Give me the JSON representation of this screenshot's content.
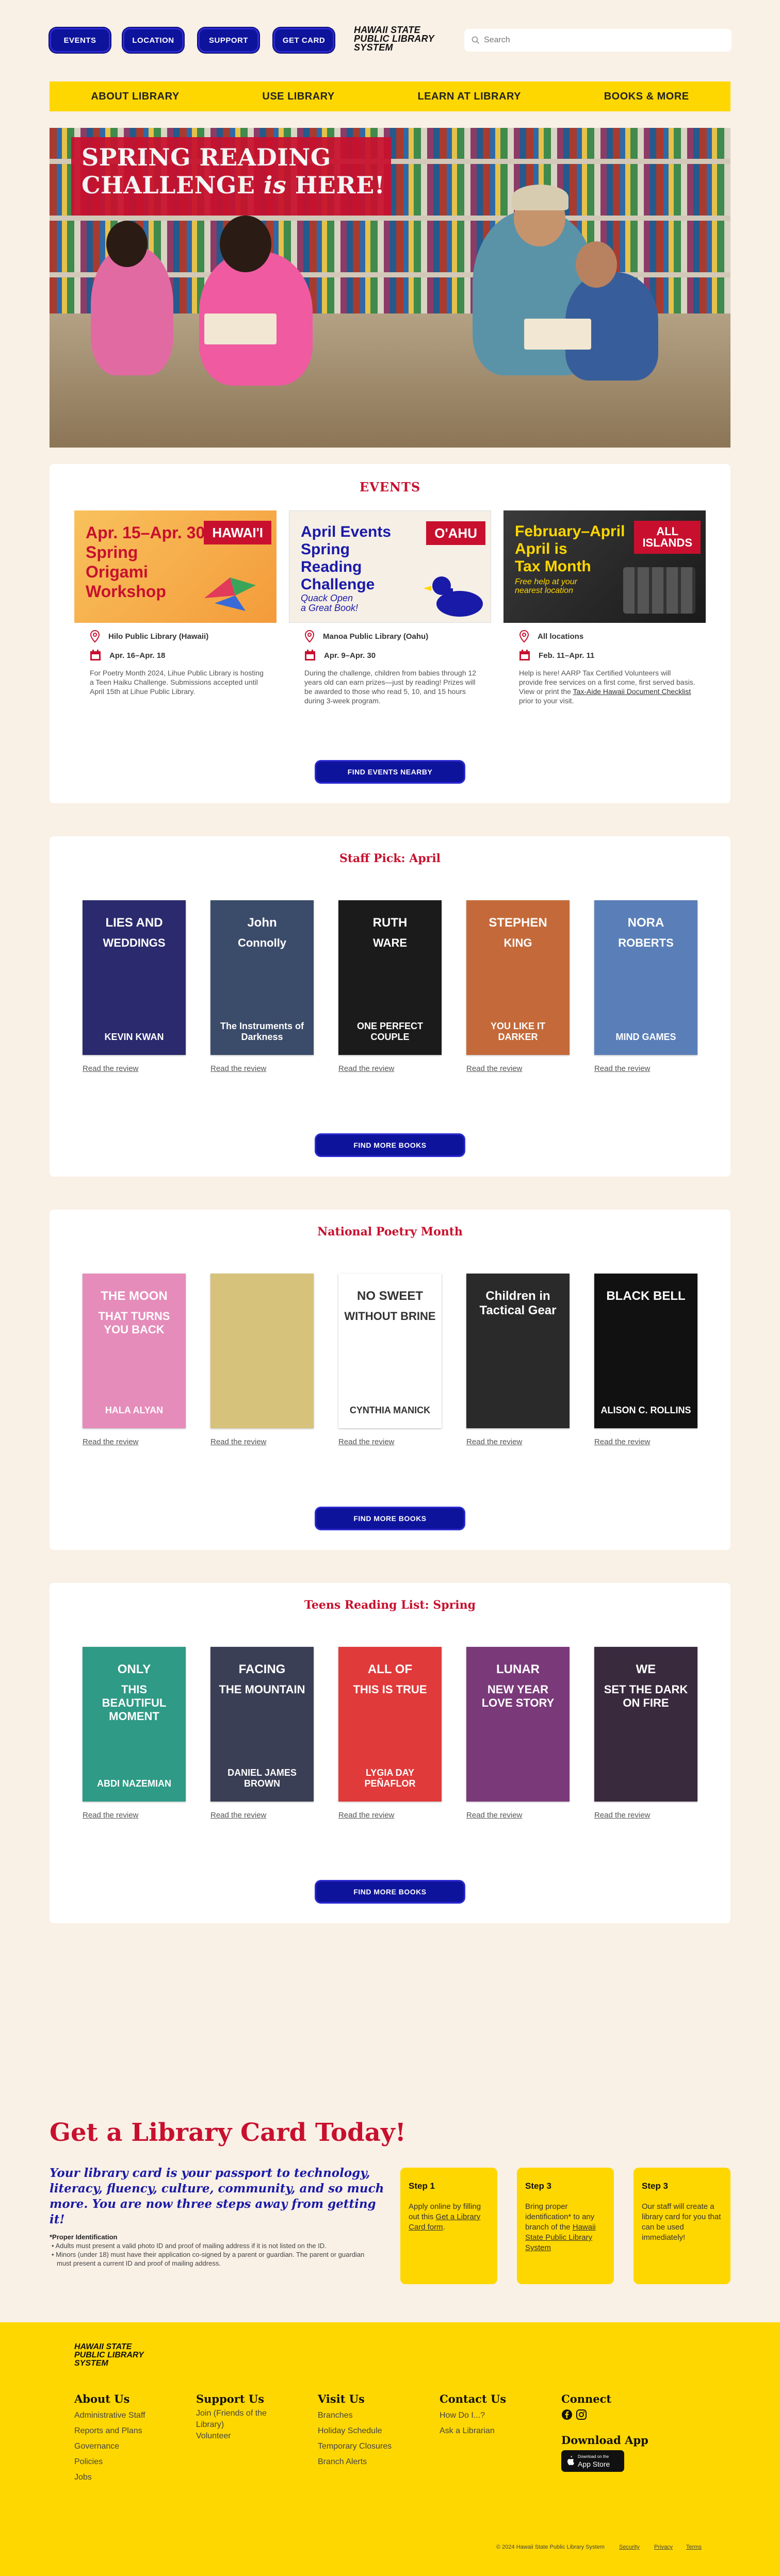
{
  "topnav": {
    "events": "EVENTS",
    "location": "LOCATION",
    "support": "SUPPORT",
    "getcard": "GET CARD"
  },
  "logo": {
    "line1": "HAWAII STATE",
    "line2": "PUBLIC LIBRARY",
    "line3": "SYSTEM"
  },
  "search": {
    "placeholder": "Search"
  },
  "mainnav": [
    "ABOUT LIBRARY",
    "USE LIBRARY",
    "LEARN AT LIBRARY",
    "BOOKS & MORE"
  ],
  "hero": {
    "line1": "SPRING READING",
    "line2a": "CHALLENGE ",
    "line2b": "is",
    "line2c": " HERE!"
  },
  "events": {
    "title": "EVENTS",
    "items": [
      {
        "img_title": "Apr. 15–Apr. 30\nSpring\nOrigami\nWorkshop",
        "tag": "HAWAI'I",
        "location": "Hilo Public Library (Hawaii)",
        "dates": "Apr. 16–Apr. 18",
        "desc": "For Poetry Month 2024, Lihue Public Library is hosting a Teen Haiku Challenge. Submissions accepted until April 15th at Lihue Public Library."
      },
      {
        "img_title": "April Events\nSpring\nReading\nChallenge",
        "img_sub": "Quack Open\na Great Book!",
        "tag": "O'AHU",
        "location": "Manoa Public Library (Oahu)",
        "dates": "Apr. 9–Apr. 30",
        "desc": "During the challenge, children from babies through 12 years old can earn prizes—just by reading! Prizes will be awarded to those who read 5, 10, and 15 hours during 3-week program."
      },
      {
        "img_title": "February–April\nApril is\nTax Month",
        "img_sub": "Free help at your\nnearest location",
        "tag": "ALL\nISLANDS",
        "location": "All locations",
        "dates": "Feb. 11–Apr. 11",
        "desc": "Help is here! AARP Tax Certified Volunteers will provide free services on a first come, first served basis. View or print the ",
        "desc_link": "Tax-Aide Hawaii Document Checklist",
        "desc_end": " prior to your visit."
      }
    ],
    "button": "FIND EVENTS NEARBY"
  },
  "staff_pick": {
    "title": "Staff Pick: April",
    "books": [
      {
        "t1": "LIES AND",
        "t2": "WEDDINGS",
        "author": "KEVIN KWAN",
        "bg": "#2b2a6e",
        "review": "Read the review"
      },
      {
        "t1": "John",
        "t2": "Connolly",
        "author": "The Instruments of Darkness",
        "bg": "#3b4b6a",
        "review": "Read the review"
      },
      {
        "t1": "RUTH",
        "t2": "WARE",
        "author": "ONE PERFECT COUPLE",
        "bg": "#1b1b1b",
        "review": "Read the review"
      },
      {
        "t1": "STEPHEN",
        "t2": "KING",
        "author": "YOU LIKE IT DARKER",
        "bg": "#c46a3a",
        "review": "Read the review"
      },
      {
        "t1": "NORA",
        "t2": "ROBERTS",
        "author": "MIND GAMES",
        "bg": "#5a7fb8",
        "review": "Read the review"
      }
    ],
    "button": "FIND MORE BOOKS"
  },
  "poetry": {
    "title": "National Poetry Month",
    "books": [
      {
        "t1": "THE MOON",
        "t2": "THAT TURNS YOU BACK",
        "author": "HALA ALYAN",
        "bg": "#e58cba",
        "review": "Read the review"
      },
      {
        "t1": "",
        "t2": "",
        "author": "",
        "bg": "#d6c27a",
        "review": "Read the review"
      },
      {
        "t1": "NO SWEET",
        "t2": "WITHOUT BRINE",
        "author": "CYNTHIA MANICK",
        "bg": "#ffffff",
        "review": "Read the review"
      },
      {
        "t1": "Children in Tactical Gear",
        "t2": "",
        "author": "",
        "bg": "#2a2a2a",
        "review": "Read the review"
      },
      {
        "t1": "BLACK BELL",
        "t2": "",
        "author": "ALISON C. ROLLINS",
        "bg": "#111111",
        "review": "Read the review"
      }
    ],
    "button": "FIND MORE BOOKS"
  },
  "teens": {
    "title": "Teens Reading List: Spring",
    "books": [
      {
        "t1": "ONLY",
        "t2": "THIS BEAUTIFUL MOMENT",
        "author": "ABDI NAZEMIAN",
        "bg": "#2f9a86",
        "review": "Read the review"
      },
      {
        "t1": "FACING",
        "t2": "THE MOUNTAIN",
        "author": "DANIEL JAMES BROWN",
        "bg": "#3a3f55",
        "review": "Read the review"
      },
      {
        "t1": "ALL OF",
        "t2": "THIS IS TRUE",
        "author": "LYGIA DAY PEÑAFLOR",
        "bg": "#e03a3a",
        "review": "Read the review"
      },
      {
        "t1": "LUNAR",
        "t2": "NEW YEAR LOVE STORY",
        "author": "",
        "bg": "#7a3a7a",
        "review": "Read the review"
      },
      {
        "t1": "WE",
        "t2": "SET THE DARK ON FIRE",
        "author": "",
        "bg": "#3a2a3e",
        "review": "Read the review"
      }
    ],
    "button": "FIND MORE BOOKS"
  },
  "library_card": {
    "title": "Get a Library Card Today!",
    "subtitle": "Your library card is your passport to technology, literacy, fluency, culture,  community, and so much more. You are now three steps away from getting it!",
    "note_head": "*Proper Identification",
    "note1": "Adults must present a valid photo ID and proof of mailing address if it is not listed on the ID.",
    "note2": "Minors (under 18) must have their application co-signed by a parent or guardian. The parent or guardian must present a current ID and proof of mailing address.",
    "steps": [
      {
        "label": "Step 1",
        "text": "Apply online by filling out this ",
        "link": "Get a Library Card form",
        "end": "."
      },
      {
        "label": "Step 3",
        "text": "Bring proper identification* to any branch of the ",
        "link": "Hawaii State Public Library System",
        "end": ""
      },
      {
        "label": "Step 3",
        "text": "Our staff will create a library card for you that can be used immediately!",
        "link": "",
        "end": ""
      }
    ]
  },
  "footer": {
    "about": {
      "head": "About Us",
      "items": [
        "Administrative Staff",
        "Reports and Plans",
        "Governance",
        "Policies",
        "Jobs"
      ]
    },
    "support": {
      "head": "Support Us",
      "items": [
        "Join (Friends of the Library)",
        "Volunteer"
      ]
    },
    "visit": {
      "head": "Visit Us",
      "items": [
        "Branches",
        "Holiday Schedule",
        "Temporary Closures",
        "Branch Alerts"
      ]
    },
    "contact": {
      "head": "Contact Us",
      "items": [
        "How Do I...?",
        "Ask a Librarian"
      ]
    },
    "connect": {
      "head": "Connect"
    },
    "app": {
      "head": "Download App",
      "small": "Download on the",
      "big": "App Store"
    },
    "copyright": "© 2024 Hawaii State Public Library System",
    "security": "Security",
    "privacy": "Privacy",
    "terms": "Terms"
  }
}
